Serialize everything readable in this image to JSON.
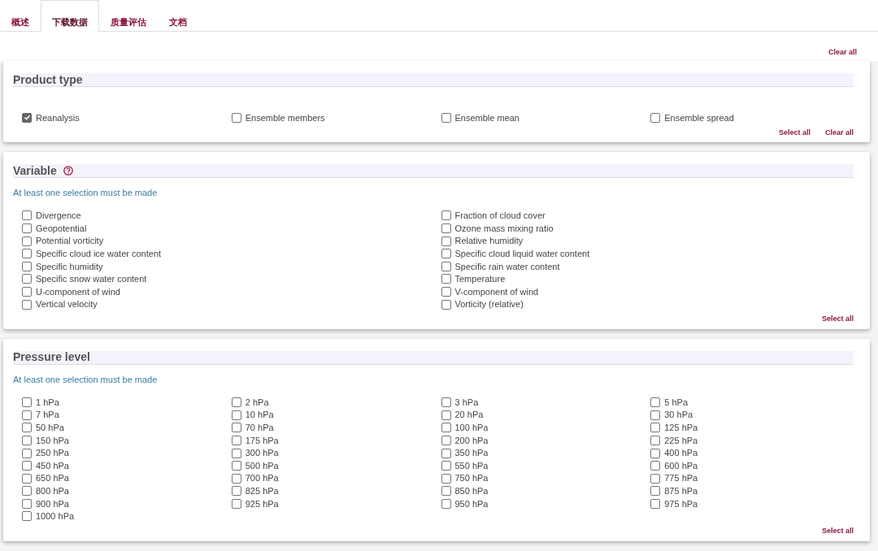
{
  "tabs": [
    {
      "label": "概述",
      "selected": false
    },
    {
      "label": "下载数据",
      "selected": true
    },
    {
      "label": "质量评估",
      "selected": false
    },
    {
      "label": "文档",
      "selected": false
    }
  ],
  "top_action": "Clear all",
  "sections": [
    {
      "kind": "product",
      "title": "Product type",
      "help": false,
      "options": [
        {
          "label": "Reanalysis",
          "checked": true
        },
        {
          "label": "Ensemble members",
          "checked": false
        },
        {
          "label": "Ensemble mean",
          "checked": false
        },
        {
          "label": "Ensemble spread",
          "checked": false
        }
      ],
      "actions": [
        "Select all",
        "Clear all"
      ]
    },
    {
      "kind": "variable",
      "title": "Variable",
      "help": true,
      "note": "At least one selection must be made",
      "options": [
        {
          "label": "Divergence",
          "checked": false
        },
        {
          "label": "Geopotential",
          "checked": false
        },
        {
          "label": "Potential vorticity",
          "checked": false
        },
        {
          "label": "Specific cloud ice water content",
          "checked": false
        },
        {
          "label": "Specific humidity",
          "checked": false
        },
        {
          "label": "Specific snow water content",
          "checked": false
        },
        {
          "label": "U-component of wind",
          "checked": false
        },
        {
          "label": "Vertical velocity",
          "checked": false
        },
        {
          "label": "Fraction of cloud cover",
          "checked": false
        },
        {
          "label": "Ozone mass mixing ratio",
          "checked": false
        },
        {
          "label": "Relative humidity",
          "checked": false
        },
        {
          "label": "Specific cloud liquid water content",
          "checked": false
        },
        {
          "label": "Specific rain water content",
          "checked": false
        },
        {
          "label": "Temperature",
          "checked": false
        },
        {
          "label": "V-component of wind",
          "checked": false
        },
        {
          "label": "Vorticity (relative)",
          "checked": false
        }
      ],
      "actions": [
        "Select all"
      ]
    },
    {
      "kind": "pressure",
      "title": "Pressure level",
      "help": false,
      "note": "At least one selection must be made",
      "options": [
        {
          "label": "1 hPa",
          "checked": false
        },
        {
          "label": "2 hPa",
          "checked": false
        },
        {
          "label": "3 hPa",
          "checked": false
        },
        {
          "label": "5 hPa",
          "checked": false
        },
        {
          "label": "7 hPa",
          "checked": false
        },
        {
          "label": "10 hPa",
          "checked": false
        },
        {
          "label": "20 hPa",
          "checked": false
        },
        {
          "label": "30 hPa",
          "checked": false
        },
        {
          "label": "50 hPa",
          "checked": false
        },
        {
          "label": "70 hPa",
          "checked": false
        },
        {
          "label": "100 hPa",
          "checked": false
        },
        {
          "label": "125 hPa",
          "checked": false
        },
        {
          "label": "150 hPa",
          "checked": false
        },
        {
          "label": "175 hPa",
          "checked": false
        },
        {
          "label": "200 hPa",
          "checked": false
        },
        {
          "label": "225 hPa",
          "checked": false
        },
        {
          "label": "250 hPa",
          "checked": false
        },
        {
          "label": "300 hPa",
          "checked": false
        },
        {
          "label": "350 hPa",
          "checked": false
        },
        {
          "label": "400 hPa",
          "checked": false
        },
        {
          "label": "450 hPa",
          "checked": false
        },
        {
          "label": "500 hPa",
          "checked": false
        },
        {
          "label": "550 hPa",
          "checked": false
        },
        {
          "label": "600 hPa",
          "checked": false
        },
        {
          "label": "650 hPa",
          "checked": false
        },
        {
          "label": "700 hPa",
          "checked": false
        },
        {
          "label": "750 hPa",
          "checked": false
        },
        {
          "label": "775 hPa",
          "checked": false
        },
        {
          "label": "800 hPa",
          "checked": false
        },
        {
          "label": "825 hPa",
          "checked": false
        },
        {
          "label": "850 hPa",
          "checked": false
        },
        {
          "label": "875 hPa",
          "checked": false
        },
        {
          "label": "900 hPa",
          "checked": false
        },
        {
          "label": "925 hPa",
          "checked": false
        },
        {
          "label": "950 hPa",
          "checked": false
        },
        {
          "label": "975 hPa",
          "checked": false
        },
        {
          "label": "1000 hPa",
          "checked": false
        }
      ],
      "actions": [
        "Select all"
      ]
    }
  ]
}
